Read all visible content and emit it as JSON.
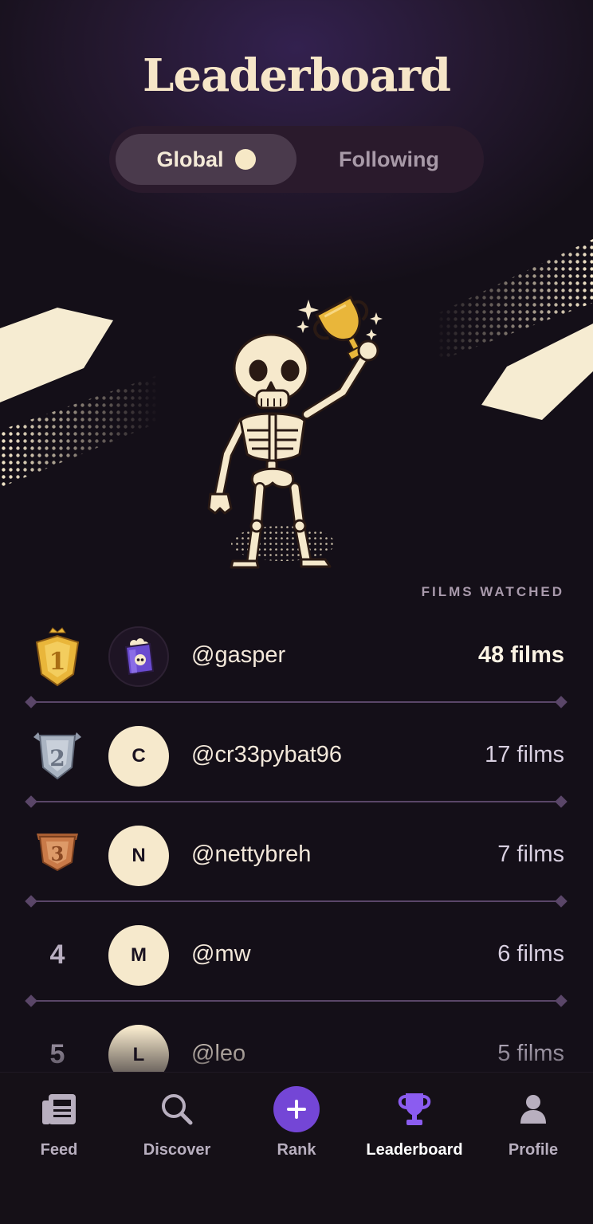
{
  "page": {
    "title": "Leaderboard",
    "tabs": {
      "global": "Global",
      "following": "Following"
    },
    "column_header": "FILMS WATCHED"
  },
  "leaderboard": [
    {
      "rank": "1",
      "badge": "gold",
      "avatar_initial": "",
      "avatar_icon": "popcorn-skull-icon",
      "username": "@gasper",
      "films": "48 films"
    },
    {
      "rank": "2",
      "badge": "silver",
      "avatar_initial": "C",
      "username": "@cr33pybat96",
      "films": "17 films"
    },
    {
      "rank": "3",
      "badge": "bronze",
      "avatar_initial": "N",
      "username": "@nettybreh",
      "films": "7 films"
    },
    {
      "rank": "4",
      "avatar_initial": "M",
      "username": "@mw",
      "films": "6 films"
    },
    {
      "rank": "5",
      "avatar_initial": "L",
      "username": "@leo",
      "films": "5 films"
    }
  ],
  "nav": {
    "items": [
      {
        "label": "Feed",
        "icon": "feed-icon"
      },
      {
        "label": "Discover",
        "icon": "search-icon"
      },
      {
        "label": "Rank",
        "icon": "plus-icon"
      },
      {
        "label": "Leaderboard",
        "icon": "trophy-icon",
        "active": true
      },
      {
        "label": "Profile",
        "icon": "person-icon"
      }
    ]
  },
  "colors": {
    "accent": "#7446d6",
    "cream": "#f6e9cc",
    "gold": "#e9b63a",
    "silver": "#aab4c2",
    "bronze": "#c97a48",
    "background": "#140f18"
  }
}
